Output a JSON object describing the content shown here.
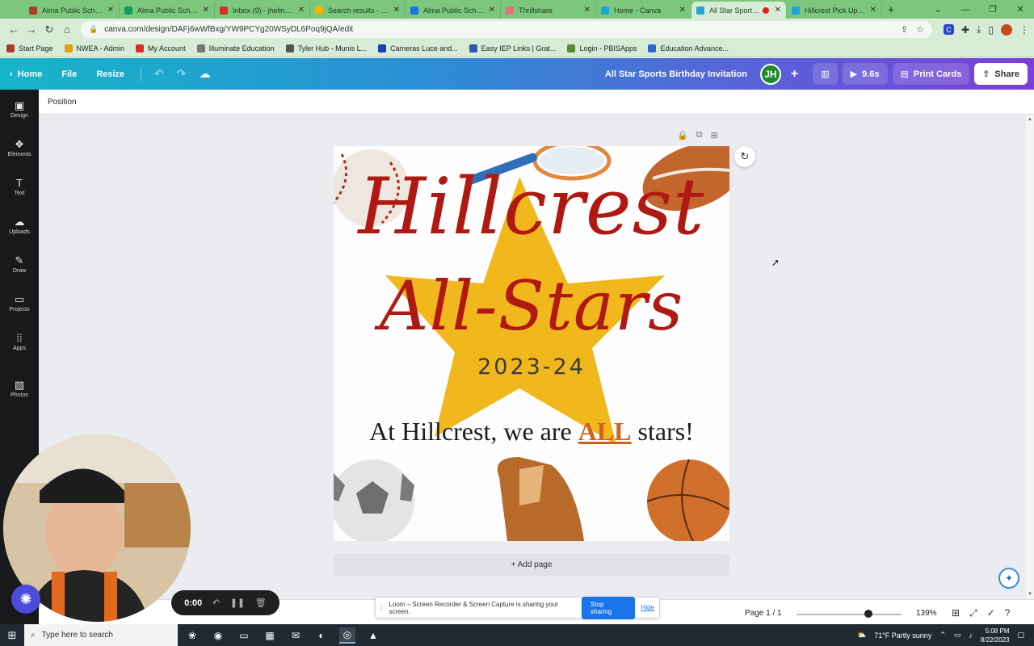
{
  "browser": {
    "tabs": [
      {
        "title": "Alma Public Schools",
        "color": "#b03a2e"
      },
      {
        "title": "Alma Public Schools",
        "color": "#0f9d58"
      },
      {
        "title": "Inbox (9) - jhelinski@",
        "color": "#d93025"
      },
      {
        "title": "Search results - Goo",
        "color": "#f4b400"
      },
      {
        "title": "Alma Public Schools",
        "color": "#1a73e8"
      },
      {
        "title": "Thrillshare",
        "color": "#e7717d"
      },
      {
        "title": "Home - Canva",
        "color": "#1fa5d8"
      },
      {
        "title": "All Star Sports Bi",
        "color": "#1fa5d8"
      },
      {
        "title": "Hillcrest Pick Up Loc",
        "color": "#1fa5d8"
      }
    ],
    "url": "canva.com/design/DAFj6wWfBxg/YW9PCYg20WSyDL6Poq9jQA/edit",
    "bookmarks": [
      {
        "label": "Start Page",
        "color": "#b03a2e"
      },
      {
        "label": "NWEA - Admin",
        "color": "#e6a100"
      },
      {
        "label": "My Account",
        "color": "#d93025"
      },
      {
        "label": "Illuminate Education",
        "color": "#777777"
      },
      {
        "label": "Tyler Hub - Munis L...",
        "color": "#555555"
      },
      {
        "label": "Cameras Luce and...",
        "color": "#1a3fb0"
      },
      {
        "label": "Easy IEP Links | Grat...",
        "color": "#3355aa"
      },
      {
        "label": "Login - PBISApps",
        "color": "#5a8a2e"
      },
      {
        "label": "Education Advance...",
        "color": "#2a6ad0"
      }
    ]
  },
  "canva_header": {
    "home": "Home",
    "file": "File",
    "resize": "Resize",
    "doc_title": "All Star Sports Birthday Invitation",
    "avatar_initials": "JH",
    "duration": "9.6s",
    "print": "Print Cards",
    "share": "Share"
  },
  "sidebar": [
    {
      "label": "Design",
      "icon": "▣"
    },
    {
      "label": "Elements",
      "icon": "❖"
    },
    {
      "label": "Text",
      "icon": "T"
    },
    {
      "label": "Uploads",
      "icon": "☁"
    },
    {
      "label": "Draw",
      "icon": "✎"
    },
    {
      "label": "Projects",
      "icon": "▭"
    },
    {
      "label": "Apps",
      "icon": "⁞⁞"
    },
    {
      "label": "Photos",
      "icon": "▨"
    }
  ],
  "toolbar": {
    "position": "Position"
  },
  "design": {
    "line1": "Hillcrest",
    "line2": "All-Stars",
    "year": "2023-24",
    "tagline_pre": "At Hillcrest, we are ",
    "tagline_em": "ALL",
    "tagline_post": " stars!",
    "colors": {
      "script": "#b01812",
      "star": "#f0b81c",
      "accent": "#d0621c"
    }
  },
  "add_page": "+ Add page",
  "footer": {
    "page": "Page 1 / 1",
    "zoom": "139%"
  },
  "loom": {
    "banner": "Loom – Screen Recorder & Screen Capture is sharing your screen.",
    "stop": "Stop sharing",
    "hide": "Hide",
    "timer": "0:00"
  },
  "taskbar": {
    "search": "Type here to search",
    "weather": "71°F  Partly sunny",
    "time": "5:08 PM",
    "date": "8/22/2023"
  }
}
